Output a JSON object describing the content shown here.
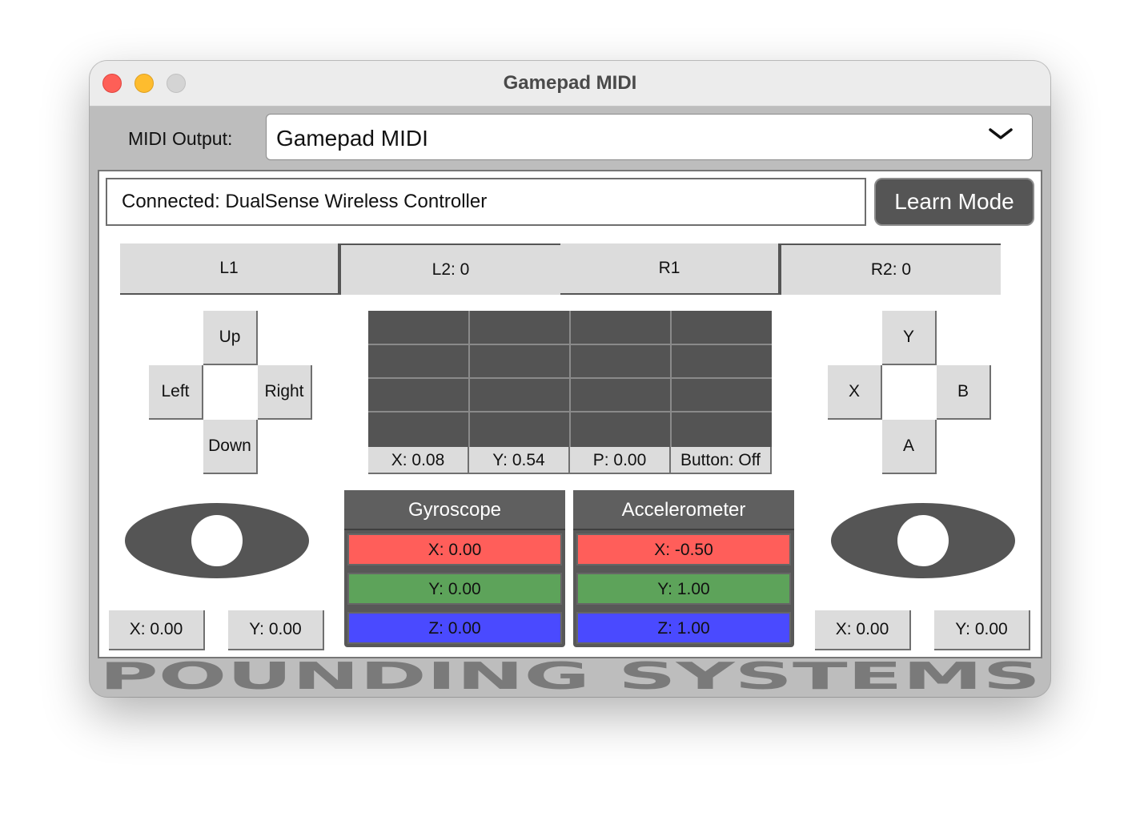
{
  "window": {
    "title": "Gamepad MIDI"
  },
  "midi": {
    "label": "MIDI Output:",
    "selected": "Gamepad MIDI"
  },
  "status": {
    "text": "Connected: DualSense Wireless Controller"
  },
  "learn_button": "Learn Mode",
  "shoulders": {
    "l1": "L1",
    "l2": "L2: 0",
    "r1": "R1",
    "r2": "R2: 0"
  },
  "dpad": {
    "up": "Up",
    "left": "Left",
    "right": "Right",
    "down": "Down"
  },
  "face": {
    "y": "Y",
    "x": "X",
    "b": "B",
    "a": "A"
  },
  "touchpad": {
    "x": "X: 0.08",
    "y": "Y: 0.54",
    "p": "P: 0.00",
    "button": "Button: Off"
  },
  "left_stick": {
    "x": "X: 0.00",
    "y": "Y: 0.00"
  },
  "right_stick": {
    "x": "X: 0.00",
    "y": "Y: 0.00"
  },
  "gyroscope": {
    "title": "Gyroscope",
    "x": "X: 0.00",
    "y": "Y: 0.00",
    "z": "Z: 0.00"
  },
  "accelerometer": {
    "title": "Accelerometer",
    "x": "X: -0.50",
    "y": "Y: 1.00",
    "z": "Z: 1.00"
  },
  "colors": {
    "x_axis": "#ff5e5a",
    "y_axis": "#5da35a",
    "z_axis": "#4a4aff",
    "accent_dark": "#555555"
  },
  "branding": {
    "logo": "POUNDING SYSTEMS"
  }
}
